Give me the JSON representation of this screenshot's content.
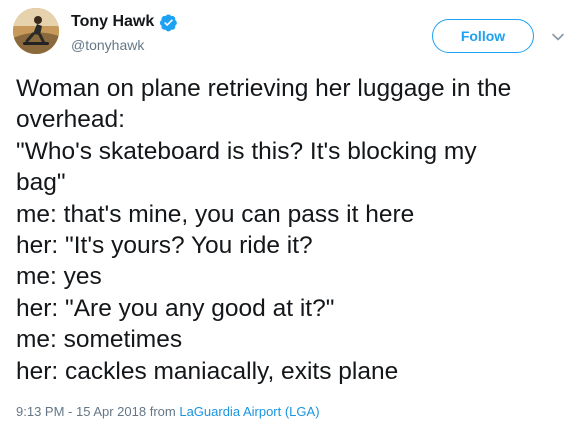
{
  "author": {
    "display_name": "Tony Hawk",
    "handle": "@tonyhawk",
    "verified": true,
    "avatar_icon": "skateboarder-avatar"
  },
  "follow_button": {
    "label": "Follow"
  },
  "menu": {
    "icon": "chevron-down-icon"
  },
  "tweet": {
    "lines": [
      "Woman on plane retrieving her luggage in the",
      "overhead:",
      "\"Who's skateboard is this? It's blocking my",
      "bag\"",
      "me: that's mine, you can pass it here",
      "her: \"It's yours? You ride it?",
      "me: yes",
      "her: \"Are you any good at it?\"",
      "me: sometimes",
      "her: cackles maniacally, exits plane"
    ]
  },
  "meta": {
    "time": "9:13 PM",
    "separator": " - ",
    "date": "15 Apr 2018",
    "from_label": " from ",
    "location": "LaGuardia Airport (LGA)"
  },
  "colors": {
    "accent": "#1da1f2",
    "text": "#14171a",
    "secondary_text": "#657786",
    "link": "#1b95e0"
  }
}
